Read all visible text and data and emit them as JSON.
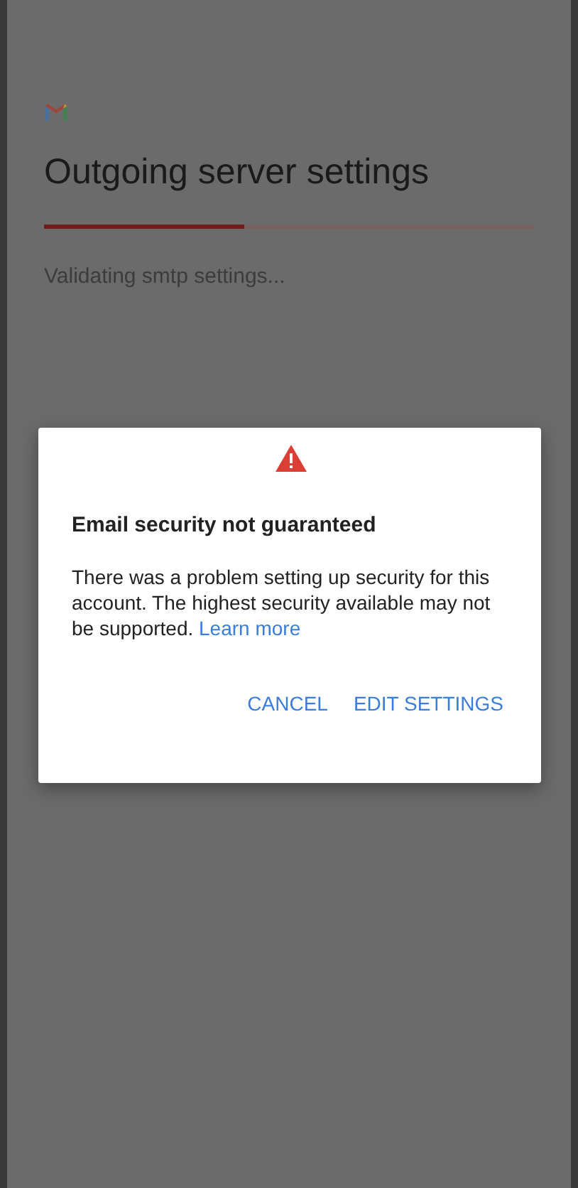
{
  "screen": {
    "title": "Outgoing server settings",
    "status": "Validating smtp settings...",
    "progress": {
      "level": 0.41
    }
  },
  "dialog": {
    "title": "Email security not guaranteed",
    "message": "There was a problem setting up security for this account. The highest security available may not be supported.",
    "link": "Learn more",
    "buttons": [
      {
        "label": "CANCEL"
      },
      {
        "label": "EDIT SETTINGS"
      }
    ]
  }
}
